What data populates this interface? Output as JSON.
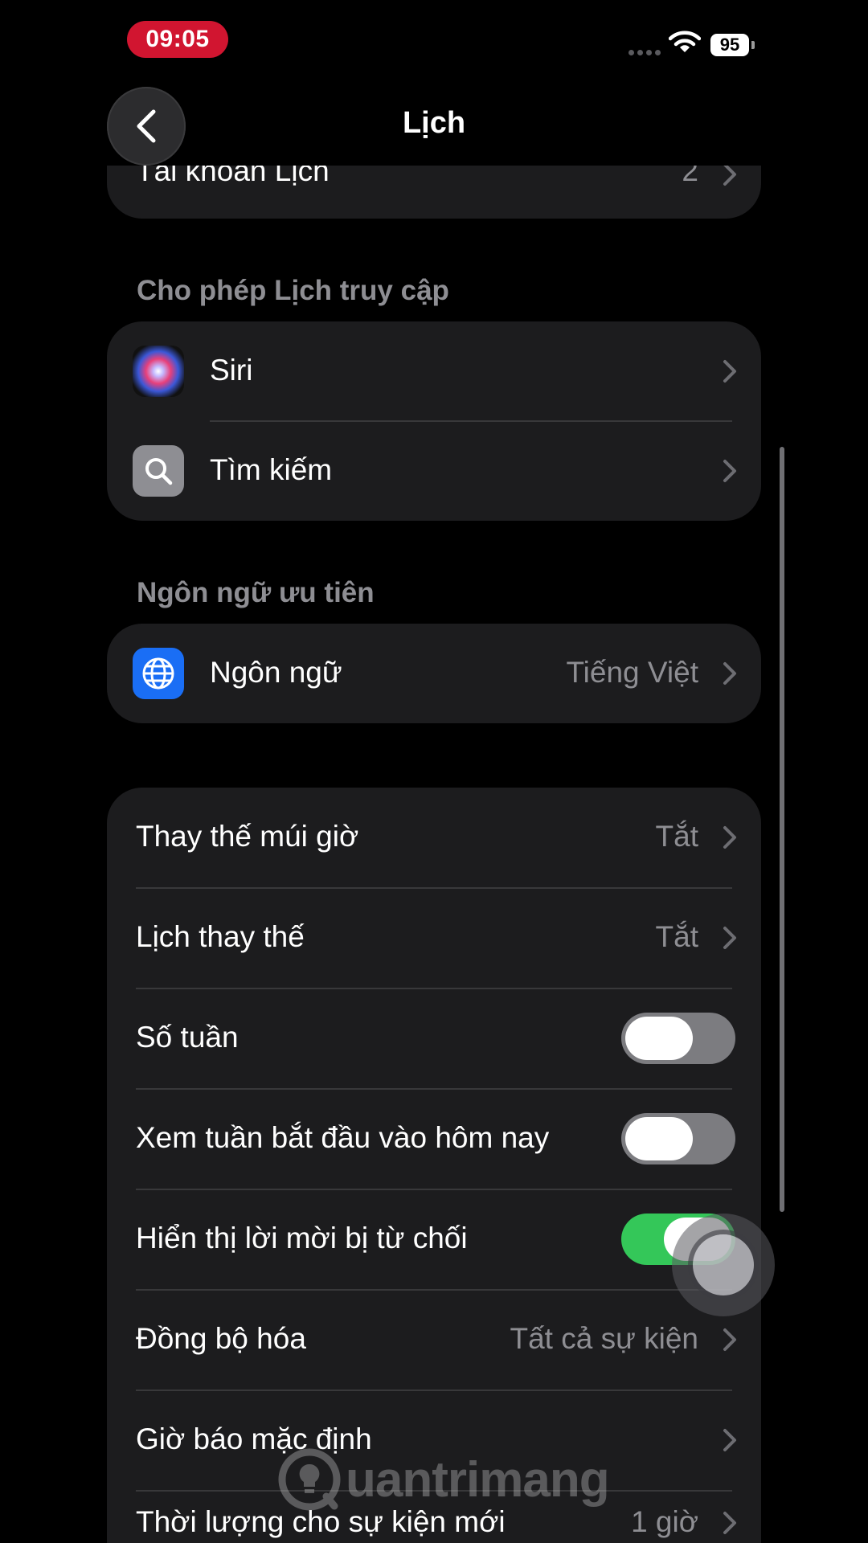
{
  "status_bar": {
    "time": "09:05",
    "battery_level": "95"
  },
  "nav": {
    "title": "Lịch"
  },
  "top_group": {
    "rows": [
      {
        "label": "Tài khoản Lịch",
        "value": "2"
      }
    ]
  },
  "access_section": {
    "header": "Cho phép Lịch truy cập",
    "rows": [
      {
        "label": "Siri",
        "icon": "siri-icon"
      },
      {
        "label": "Tìm kiếm",
        "icon": "search-icon"
      }
    ]
  },
  "language_section": {
    "header": "Ngôn ngữ ưu tiên",
    "rows": [
      {
        "label": "Ngôn ngữ",
        "value": "Tiếng Việt",
        "icon": "globe-icon"
      }
    ]
  },
  "settings_group": {
    "rows": [
      {
        "label": "Thay thế múi giờ",
        "value": "Tắt"
      },
      {
        "label": "Lịch thay thế",
        "value": "Tắt"
      },
      {
        "label": "Số tuần",
        "toggle": false
      },
      {
        "label": "Xem tuần bắt đầu vào hôm nay",
        "toggle": false
      },
      {
        "label": "Hiển thị lời mời bị từ chối",
        "toggle": true
      },
      {
        "label": "Đồng bộ hóa",
        "value": "Tất cả sự kiện"
      },
      {
        "label": "Giờ báo mặc định",
        "value": ""
      },
      {
        "label": "Thời lượng cho sự kiện mới",
        "value": "1 giờ"
      }
    ]
  },
  "watermark": {
    "text": "uantrimang"
  },
  "colors": {
    "toggle_on": "#34c759",
    "toggle_off": "#7c7c80",
    "time_pill": "#d11530",
    "group_bg": "#1c1c1e"
  }
}
